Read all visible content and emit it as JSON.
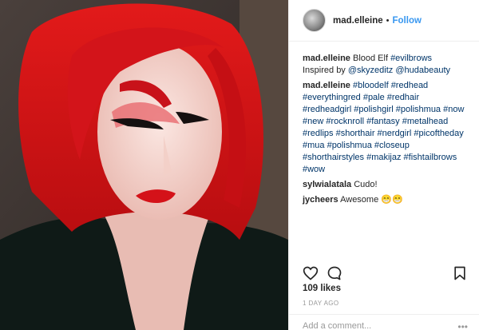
{
  "header": {
    "username": "mad.elleine",
    "separator": "•",
    "follow_label": "Follow"
  },
  "comments": [
    {
      "user": "mad.elleine",
      "parts": [
        {
          "text": " Blood Elf ",
          "link": false
        },
        {
          "text": "#evilbrows",
          "link": true
        },
        {
          "text": " Inspired by ",
          "link": false
        },
        {
          "text": "@skyzeditz",
          "link": true
        },
        {
          "text": " ",
          "link": false
        },
        {
          "text": "@hudabeauty",
          "link": true
        }
      ]
    },
    {
      "user": "mad.elleine",
      "parts": [
        {
          "text": " ",
          "link": false
        },
        {
          "text": "#bloodelf #redhead #everythingred #pale #redhair #redheadgirl #polishgirl #polishmua #now #new #rocknroll #fantasy #metalhead #redlips #shorthair #nerdgirl #picoftheday #mua #polishmua #closeup #shorthairstyles #makijaz #fishtailbrows #wow",
          "link": true
        }
      ]
    },
    {
      "user": "sylwialatala",
      "parts": [
        {
          "text": " Cudo!",
          "link": false
        }
      ]
    },
    {
      "user": "jycheers",
      "parts": [
        {
          "text": " Awesome 😁😁",
          "link": false
        }
      ]
    }
  ],
  "actions": {
    "like_icon": "heart-icon",
    "comment_icon": "comment-bubble-icon",
    "save_icon": "bookmark-icon"
  },
  "likes": "109 likes",
  "timestamp": "1 DAY AGO",
  "add_comment": {
    "placeholder": "Add a comment...",
    "more": "•••"
  },
  "colors": {
    "link": "#003569",
    "follow": "#3897f0",
    "text": "#262626",
    "muted": "#999999"
  }
}
